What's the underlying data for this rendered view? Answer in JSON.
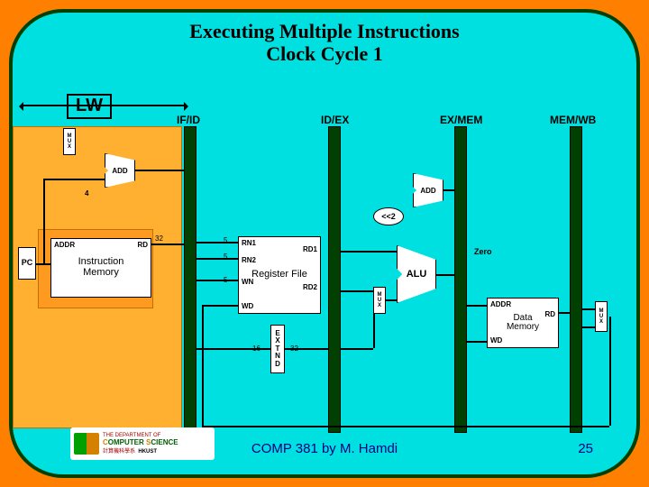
{
  "title_line1": "Executing Multiple Instructions",
  "title_line2": "Clock Cycle 1",
  "stage_span_label": "LW",
  "pipe_regs": {
    "ifid": "IF/ID",
    "idex": "ID/EX",
    "exmem": "EX/MEM",
    "memwb": "MEM/WB"
  },
  "mux_label": "MUX",
  "blocks": {
    "pc": "PC",
    "imem_addr": "ADDR",
    "imem_rd": "RD",
    "imem": "Instruction\nMemory",
    "add1": "ADD",
    "const4": "4",
    "regfile": "Register\nFile",
    "rn1": "RN1",
    "rn2": "RN2",
    "wn": "WN",
    "wd": "WD",
    "rd1": "RD1",
    "rd2": "RD2",
    "extnd": "E\nX\nT\nN\nD",
    "shift2": "<<2",
    "add2": "ADD",
    "alu": "ALU",
    "zero": "Zero",
    "dmem": "Data\nMemory",
    "dmem_addr": "ADDR",
    "dmem_rd": "RD",
    "dmem_wd": "WD"
  },
  "bus_widths": {
    "rd32": "32",
    "n5a": "5",
    "n5b": "5",
    "n5c": "5",
    "ext16": "16",
    "ext32": "32"
  },
  "footer": {
    "dept_top": "THE DEPARTMENT OF",
    "dept_main_a": "C",
    "dept_main_b": "OMPUTER ",
    "dept_main_c": "S",
    "dept_main_d": "CIENCE",
    "dept_cn": "計算機科學系",
    "dept_hkust": "HKUST",
    "center": "COMP 381 by M. Hamdi",
    "page": "25"
  }
}
